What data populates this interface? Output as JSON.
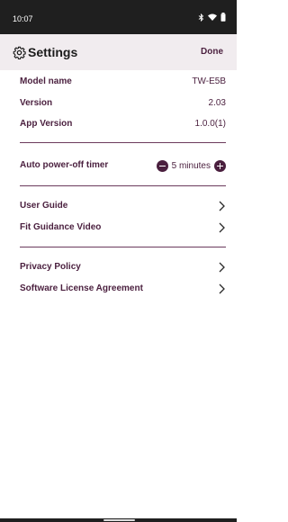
{
  "status_bar": {
    "time": "10:07",
    "icons": [
      "bluetooth-icon",
      "wifi-icon",
      "battery-icon"
    ]
  },
  "header": {
    "title": "Settings",
    "done_label": "Done",
    "icon": "gear-icon"
  },
  "device_info": [
    {
      "label": "Model name",
      "value": "TW-E5B"
    },
    {
      "label": "Version",
      "value": "2.03"
    },
    {
      "label": "App Version",
      "value": "1.0.0(1)"
    }
  ],
  "timer": {
    "label": "Auto power-off timer",
    "value": "5 minutes"
  },
  "guides": [
    {
      "label": "User Guide"
    },
    {
      "label": "Fit Guidance Video"
    }
  ],
  "legal": [
    {
      "label": "Privacy Policy"
    },
    {
      "label": "Software License Agreement"
    }
  ],
  "colors": {
    "accent": "#4a1f3e",
    "header_bg": "#f1ecef",
    "status_bar_bg": "#1f1f1f"
  }
}
